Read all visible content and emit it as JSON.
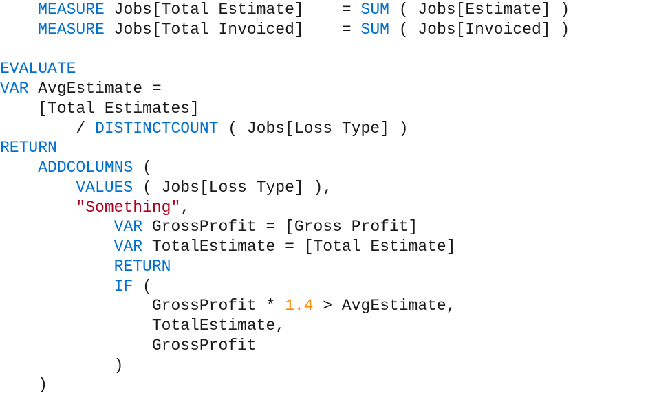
{
  "code": {
    "l1_measure": "MEASURE",
    "l1_rest": " Jobs[Total Estimate]    = ",
    "l1_sum": "SUM",
    "l1_tail": " ( Jobs[Estimate] )",
    "l2_measure": "MEASURE",
    "l2_rest": " Jobs[Total Invoiced]    = ",
    "l2_sum": "SUM",
    "l2_tail": " ( Jobs[Invoiced] )",
    "l3_evaluate": "EVALUATE",
    "l4_var": "VAR",
    "l4_rest": " AvgEstimate =",
    "l5": "    [Total Estimates]",
    "l6_slash": "        / ",
    "l6_func": "DISTINCTCOUNT",
    "l6_tail": " ( Jobs[Loss Type] )",
    "l7_return": "RETURN",
    "l8_indent": "    ",
    "l8_func": "ADDCOLUMNS",
    "l8_paren": " (",
    "l9_indent": "        ",
    "l9_func": "VALUES",
    "l9_tail": " ( Jobs[Loss Type] ),",
    "l10_indent": "        ",
    "l10_str": "\"Something\"",
    "l10_comma": ",",
    "l11_indent": "            ",
    "l11_var": "VAR",
    "l11_rest": " GrossProfit = [Gross Profit]",
    "l12_indent": "            ",
    "l12_var": "VAR",
    "l12_rest": " TotalEstimate = [Total Estimate]",
    "l13_indent": "            ",
    "l13_return": "RETURN",
    "l14_indent": "            ",
    "l14_if": "IF",
    "l14_paren": " (",
    "l15_indent": "                GrossProfit * ",
    "l15_num": "1.4",
    "l15_tail": " > AvgEstimate,",
    "l16": "                TotalEstimate,",
    "l17": "                GrossProfit",
    "l18": "            )",
    "l19": "    )"
  }
}
